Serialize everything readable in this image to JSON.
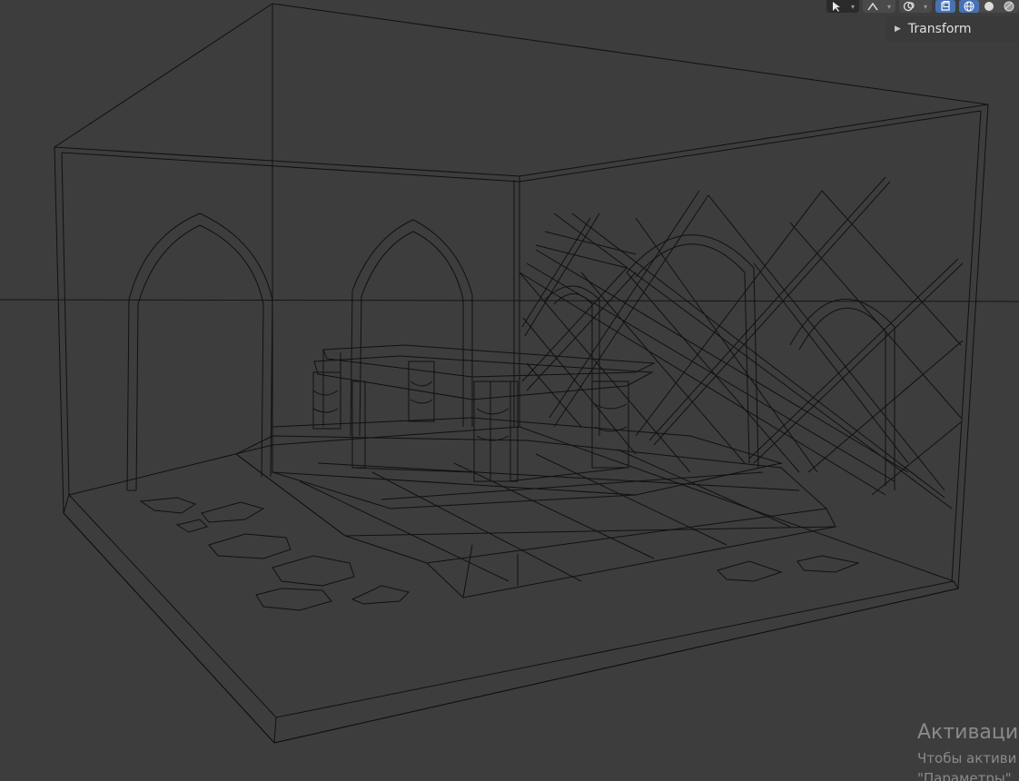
{
  "viewport": {
    "background": "#3d3d3d",
    "wire_color": "#111111",
    "horizon_color": "#151515"
  },
  "header_tools": [
    {
      "icon": "select-cursor-icon",
      "dark": true
    },
    {
      "icon": "transform-gizmo-icon"
    },
    {
      "icon": "overlays-icon"
    },
    {
      "icon": "xray-toggle-icon",
      "active": true
    },
    {
      "icon": "shading-wireframe-icon",
      "active": true
    },
    {
      "icon": "shading-solid-icon"
    },
    {
      "icon": "shading-material-icon"
    }
  ],
  "sidebar": {
    "panel_title": "Transform",
    "collapsed": true
  },
  "watermark": {
    "title": "Активация",
    "line1": "Чтобы активи",
    "line2": "\"Параметры\""
  }
}
